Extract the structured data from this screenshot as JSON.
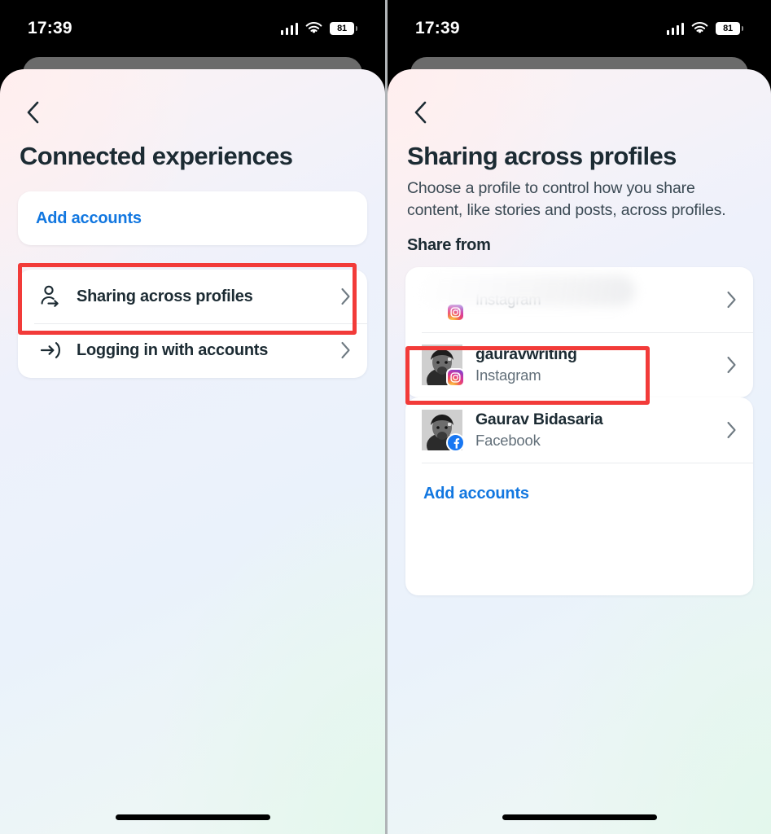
{
  "status_bar": {
    "time": "17:39",
    "battery_percent": "81",
    "icons": [
      "cellular-signal-icon",
      "wifi-icon",
      "battery-icon"
    ]
  },
  "colors": {
    "link_blue": "#1277e0",
    "highlight_red": "#f23b39",
    "title_dark": "#1c2b33",
    "secondary_text": "#63707a",
    "facebook_blue": "#1877f2"
  },
  "left_screen": {
    "back_label": "Back",
    "title": "Connected experiences",
    "add_accounts_label": "Add accounts",
    "menu_items": [
      {
        "label": "Sharing across profiles",
        "icon": "person-share-icon",
        "highlighted": true
      },
      {
        "label": "Logging in with accounts",
        "icon": "login-arrow-icon",
        "highlighted": false
      }
    ]
  },
  "right_screen": {
    "back_label": "Back",
    "title": "Sharing across profiles",
    "subtitle": "Choose a profile to control how you share content, like stories and posts, across profiles.",
    "section_label": "Share from",
    "accounts": [
      {
        "name": "",
        "platform": "Instagram",
        "badge": "instagram-icon",
        "redacted": true,
        "highlighted": false
      },
      {
        "name": "gauravwriting",
        "platform": "Instagram",
        "badge": "instagram-icon",
        "redacted": false,
        "highlighted": true
      },
      {
        "name": "Gaurav Bidasaria",
        "platform": "Facebook",
        "badge": "facebook-icon",
        "redacted": false,
        "highlighted": false
      }
    ],
    "add_accounts_label": "Add accounts"
  }
}
